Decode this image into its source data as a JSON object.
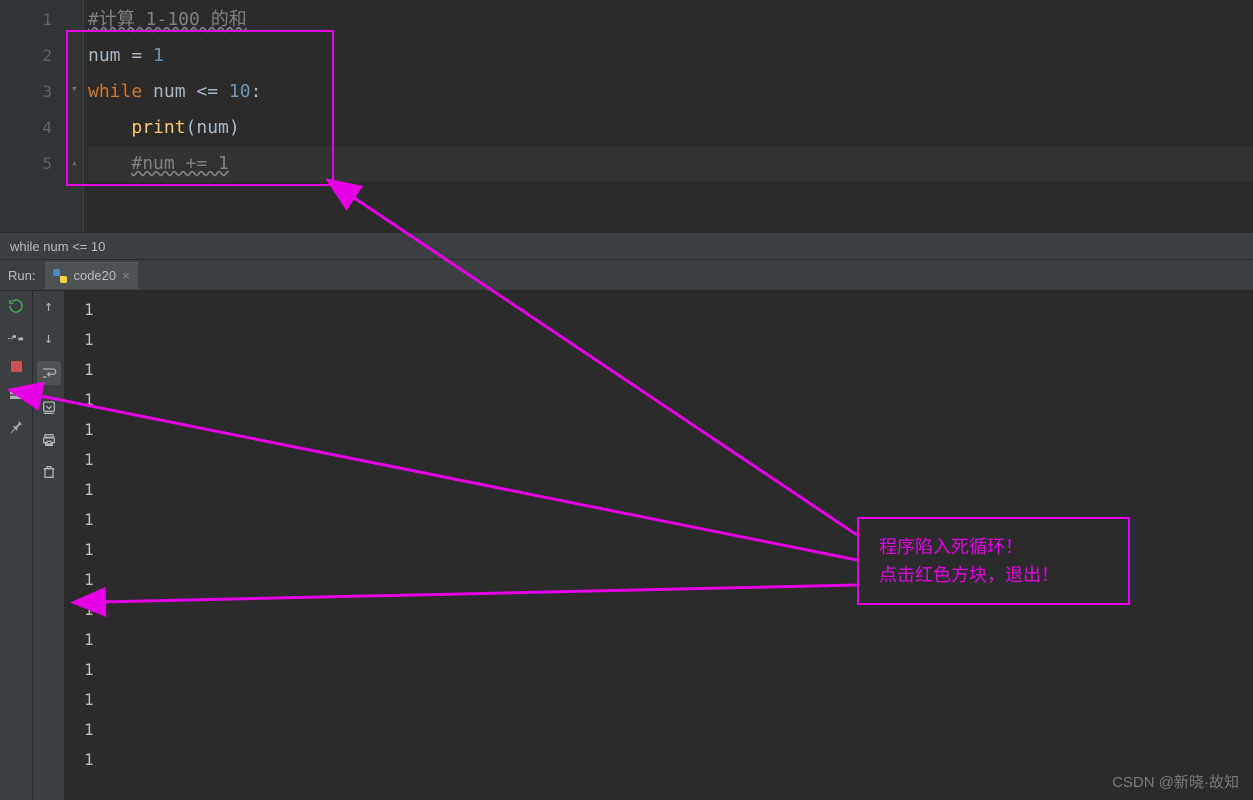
{
  "editor": {
    "line_numbers": [
      "1",
      "2",
      "3",
      "4",
      "5"
    ],
    "lines": [
      {
        "tokens": [
          {
            "t": "#计算 1-100 的和",
            "cls": "cm wavy"
          }
        ]
      },
      {
        "tokens": [
          {
            "t": "num ",
            "cls": "id"
          },
          {
            "t": "= ",
            "cls": "id"
          },
          {
            "t": "1",
            "cls": "num"
          }
        ]
      },
      {
        "tokens": [
          {
            "t": "while ",
            "cls": "kw"
          },
          {
            "t": "num <= ",
            "cls": "id"
          },
          {
            "t": "10",
            "cls": "num"
          },
          {
            "t": ":",
            "cls": "id"
          }
        ]
      },
      {
        "tokens": [
          {
            "t": "    ",
            "cls": ""
          },
          {
            "t": "print",
            "cls": "fn"
          },
          {
            "t": "(num)",
            "cls": "id"
          }
        ]
      },
      {
        "tokens": [
          {
            "t": "    ",
            "cls": ""
          },
          {
            "t": "#num += 1",
            "cls": "cm wavy"
          }
        ],
        "caret": true
      }
    ]
  },
  "breadcrumb": "while num <= 10",
  "run": {
    "label": "Run:",
    "tab_name": "code20",
    "output_lines": [
      "1",
      "1",
      "1",
      "1",
      "1",
      "1",
      "1",
      "1",
      "1",
      "1",
      "1",
      "1",
      "1",
      "1",
      "1",
      "1"
    ]
  },
  "annotation": {
    "line1": "程序陷入死循环！",
    "line2": "点击红色方块，退出！"
  },
  "watermark": "CSDN @新晓·故知"
}
